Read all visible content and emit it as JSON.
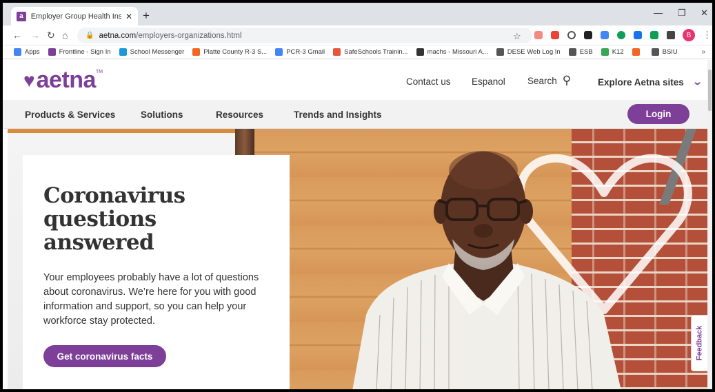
{
  "browser": {
    "tab_title": "Employer Group Health Insurance",
    "tab_favicon": "a",
    "url_host": "aetna.com",
    "url_path": "/employers-organizations.html",
    "profile_initial": "B"
  },
  "bookmarks": [
    {
      "label": "Apps",
      "icon": "apps-grid-icon",
      "color": "#4285f4"
    },
    {
      "label": "Frontline - Sign In",
      "icon": "frontline-icon",
      "color": "#7d3f98"
    },
    {
      "label": "School Messenger",
      "icon": "messenger-icon",
      "color": "#1a9bd7"
    },
    {
      "label": "Platte County R-3 S...",
      "icon": "platte-icon",
      "color": "#f26522"
    },
    {
      "label": "PCR-3 Gmail",
      "icon": "google-icon",
      "color": "#4285f4"
    },
    {
      "label": "SafeSchools Trainin...",
      "icon": "safeschools-icon",
      "color": "#e8553a"
    },
    {
      "label": "machs - Missouri A...",
      "icon": "machs-icon",
      "color": "#333333"
    },
    {
      "label": "DESE Web Log In",
      "icon": "globe-icon",
      "color": "#555555"
    },
    {
      "label": "ESB",
      "icon": "globe-icon",
      "color": "#555555"
    },
    {
      "label": "K12",
      "icon": "k12-icon",
      "color": "#3aa655"
    },
    {
      "label": "",
      "icon": "star-burst-icon",
      "color": "#f26522"
    },
    {
      "label": "BSIU",
      "icon": "globe-icon",
      "color": "#555555"
    }
  ],
  "site": {
    "brand": "aetna",
    "brand_color": "#7d3f98",
    "utility": {
      "contact": "Contact us",
      "espanol": "Espanol",
      "search": "Search",
      "explore": "Explore Aetna sites"
    },
    "nav": [
      "Products & Services",
      "Solutions",
      "Resources",
      "Trends and Insights"
    ],
    "login": "Login"
  },
  "hero": {
    "headline": "Coronavirus questions answered",
    "body": "Your employees probably have a lot of questions about coronavirus. We’re here for you with good information and support, so you can help your workforce stay protected.",
    "cta": "Get coronavirus facts"
  },
  "feedback": "Feedback"
}
